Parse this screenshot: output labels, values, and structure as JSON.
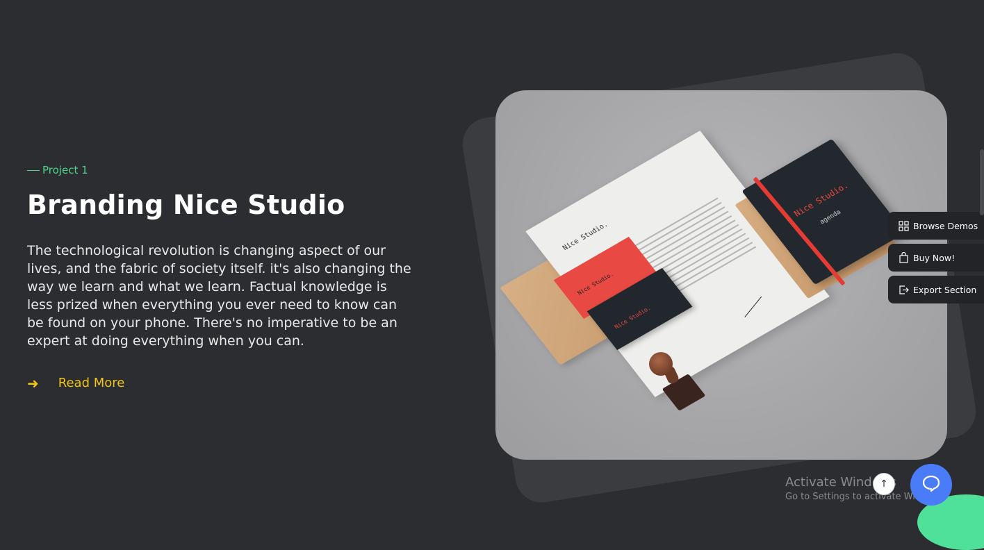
{
  "project": {
    "eyebrow": "Project 1",
    "title": "Branding Nice Studio",
    "description": "The technological revolution is changing aspect of our lives, and the fabric of society itself. it's also changing the way we learn and what we learn. Factual knowledge is less prized when everything you ever need to know can be found on your phone. There's no imperative to be an expert at doing everything when you can.",
    "read_more": "Read More"
  },
  "mockup": {
    "paper_logo": "Nice Studio.",
    "card_logo": "Nice Studio.",
    "notebook_title": "Nice Studio.",
    "notebook_sub": "agenda"
  },
  "side_panel": {
    "browse_demos": "Browse Demos",
    "buy_now": "Buy Now!",
    "export_section": "Export Section"
  },
  "watermark": {
    "line1": "Activate Windows",
    "line2": "Go to Settings to activate Windows."
  },
  "colors": {
    "background": "#2c2d31",
    "eyebrow": "#4fd48a",
    "accent": "#f0c419",
    "chat": "#4a7cf7"
  }
}
